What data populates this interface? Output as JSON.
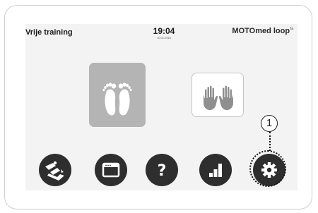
{
  "header": {
    "title": "Vrije training",
    "time": "19:04",
    "date": "10.01.2016",
    "brand": "MOTOmed loop",
    "brand_suffix": "la"
  },
  "modes": [
    {
      "name": "legs",
      "icon": "feet-icon",
      "selected": true
    },
    {
      "name": "arms",
      "icon": "hands-icon",
      "selected": false
    }
  ],
  "toolbar": [
    {
      "icon": "training-mode-icon"
    },
    {
      "icon": "program-window-icon"
    },
    {
      "icon": "question-mark-icon"
    },
    {
      "icon": "bar-chart-icon"
    },
    {
      "icon": "gear-icon"
    }
  ],
  "callout": {
    "label": "1"
  }
}
